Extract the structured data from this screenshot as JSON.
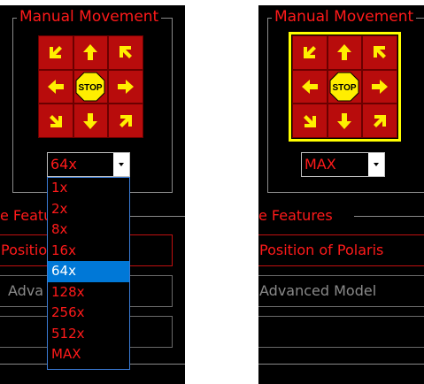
{
  "left_panel": {
    "group_title": "Manual Movement",
    "speed_value": "64x",
    "speed_options": [
      "1x",
      "2x",
      "8x",
      "16x",
      "64x",
      "128x",
      "256x",
      "512x",
      "MAX"
    ],
    "selected_option": "64x",
    "features_title": "e Featu",
    "position_button": "Positio",
    "advanced_button": "Adva"
  },
  "right_panel": {
    "group_title": "Manual Movement",
    "speed_value": "MAX",
    "features_title": "e Features",
    "position_button": "Position of Polaris",
    "advanced_button": "Advanced Model"
  },
  "pad": {
    "stop_label": "STOP",
    "arrows": [
      "up-left",
      "up",
      "up-right",
      "left",
      "stop",
      "right",
      "down-left",
      "down",
      "down-right"
    ]
  },
  "colors": {
    "background": "#000000",
    "accent_red": "#ff1a1a",
    "pad_red": "#b80c0c",
    "arrow_yellow": "#ffee00",
    "focus_yellow": "#ffff00",
    "selection_blue": "#0078d7"
  }
}
